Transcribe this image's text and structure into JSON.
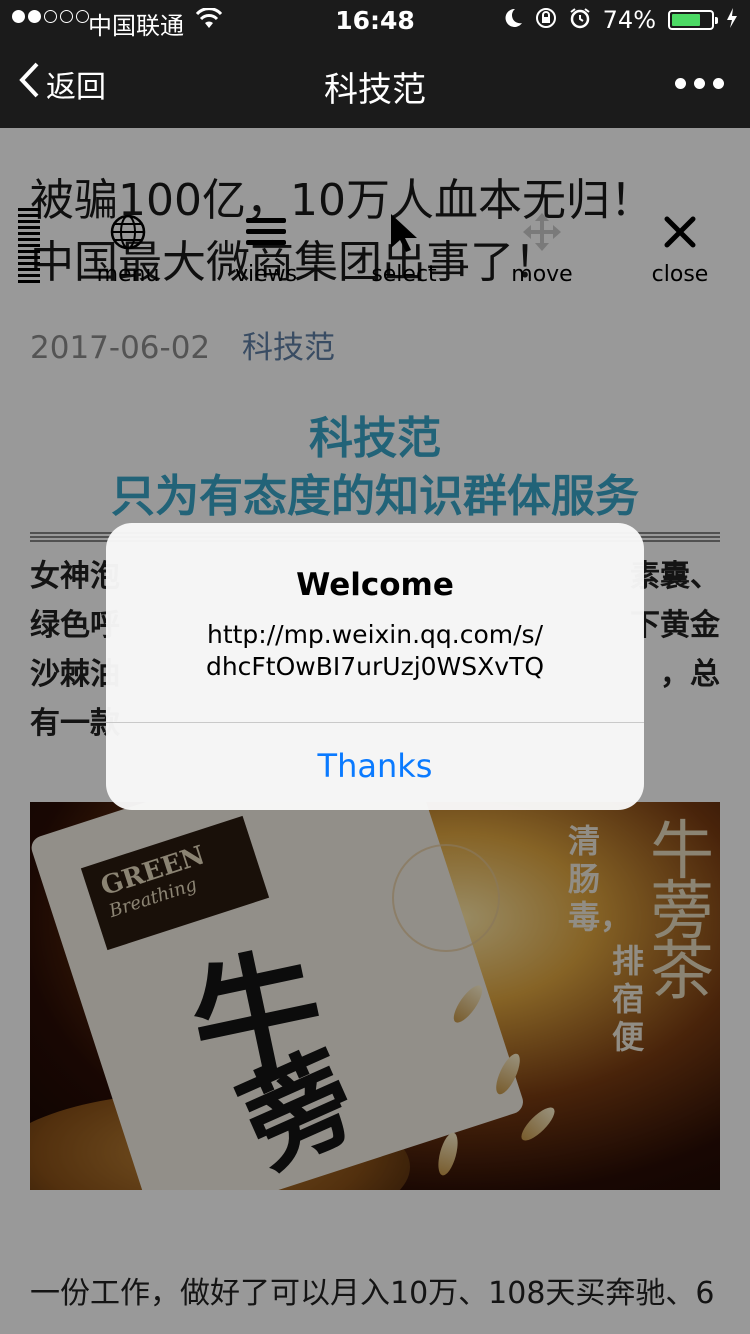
{
  "status_bar": {
    "carrier": "中国联通",
    "time": "16:48",
    "battery": "74%",
    "battery_level": 0.74,
    "signal_bars": 2,
    "icons": [
      "signal-dots-icon",
      "wifi-icon",
      "moon-icon",
      "rotation-lock-icon",
      "alarm-icon",
      "battery-icon",
      "charging-bolt-icon"
    ]
  },
  "nav": {
    "back_label": "返回",
    "title": "科技范",
    "icons": [
      "chevron-left-icon",
      "more-dots-icon"
    ]
  },
  "article": {
    "title_line1": "被骗100亿，10万人血本无归！",
    "title_line2": "中国最大微商集团出事了！",
    "date": "2017-06-02",
    "author": "科技范",
    "banner_line1": "科技范",
    "banner_line2": "只为有态度的知识群体服务",
    "body_lines": [
      {
        "left": "女神泡",
        "right": "素囊、"
      },
      {
        "left": "绿色呼",
        "right": "下黄金"
      },
      {
        "left": "沙棘油",
        "right": "，总"
      },
      {
        "left": "有一款",
        "right": ""
      }
    ],
    "image_text": {
      "brand": "GREEN",
      "brand_sub": "Breathing",
      "slogan_line1": "清肠毒，",
      "slogan_line2": "排宿便"
    },
    "para2_line1": "一份工作，做好了可以月入10万、108天买奔驰、6"
  },
  "toolbar": {
    "items": [
      {
        "label": "menu",
        "icon": "globe-icon"
      },
      {
        "label": "views",
        "icon": "hamburger-icon"
      },
      {
        "label": "select",
        "icon": "cursor-arrow-icon"
      },
      {
        "label": "move",
        "icon": "move-arrows-icon"
      },
      {
        "label": "close",
        "icon": "close-icon"
      }
    ]
  },
  "alert": {
    "title": "Welcome",
    "message_line1": "http://mp.weixin.qq.com/s/",
    "message_line2": "dhcFtOwBI7urUzj0WSXvTQ",
    "button": "Thanks"
  },
  "colors": {
    "bar_bg": "#1b1b1b",
    "link": "#607fa6",
    "banner": "#3aa6c9",
    "alert_button": "#0a7aff",
    "battery_fill": "#4cd964"
  }
}
